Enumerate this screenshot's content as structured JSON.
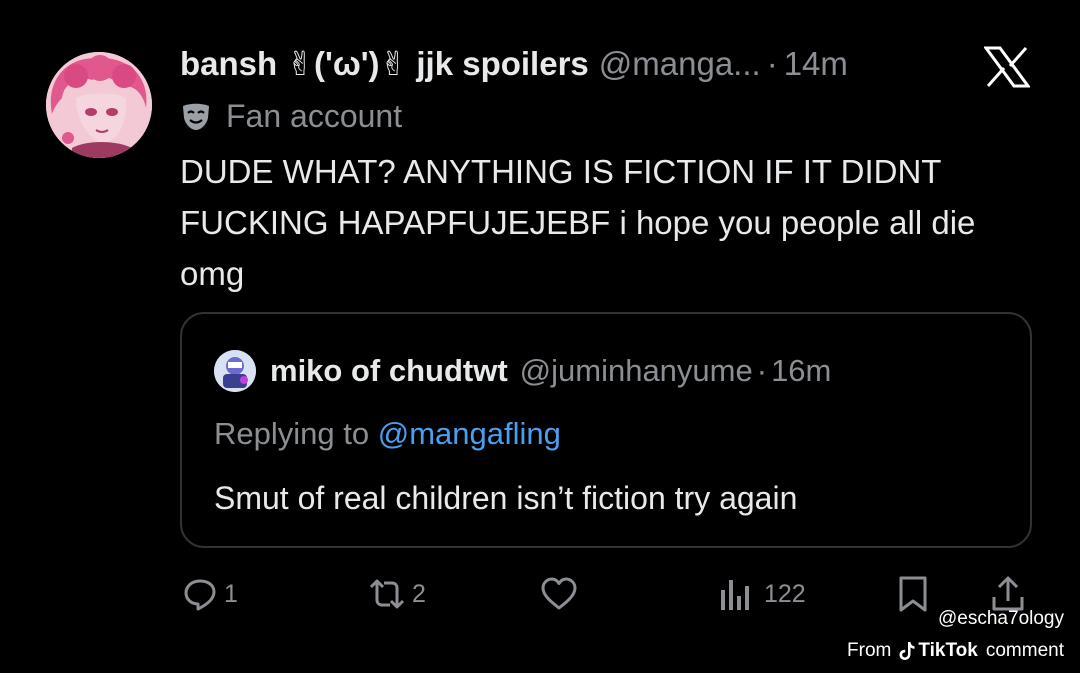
{
  "tweet": {
    "display_name": "bansh ✌('ω')✌ jjk spoilers",
    "handle": "@manga...",
    "separator": "·",
    "time": "14m",
    "label": "Fan account",
    "text": "DUDE WHAT? ANYTHING IS FICTION IF IT DIDNT FUCKING HAPAPFUJEJEBF i hope you people all die omg"
  },
  "quote": {
    "display_name": "miko of chudtwt",
    "handle": "@juminhanyume",
    "separator": "·",
    "time": "16m",
    "replying_prefix": "Replying to ",
    "replying_mention": "@mangafling",
    "text": "Smut of real children isn’t fiction try again"
  },
  "actions": {
    "replies": "1",
    "reposts": "2",
    "views": "122"
  },
  "icons": [
    "x-logo-icon",
    "mask-icon",
    "reply-icon",
    "repost-icon",
    "like-icon",
    "views-icon",
    "bookmark-icon",
    "share-icon",
    "tiktok-icon"
  ],
  "colors": {
    "background": "#000000",
    "text": "#e7e9ea",
    "secondary": "#8b8f94",
    "mention": "#4a9ff0",
    "border": "#2f3336"
  },
  "watermark": {
    "handle": "@escha7ology",
    "from": "From",
    "brand": "TikTok",
    "suffix": "comment"
  }
}
